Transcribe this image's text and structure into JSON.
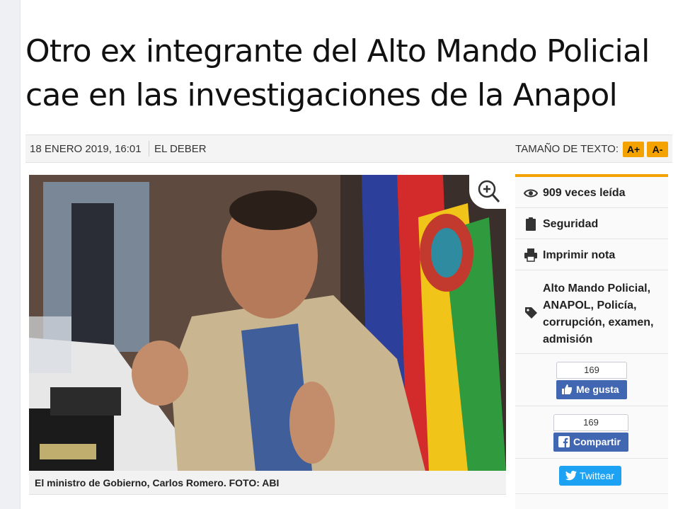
{
  "article": {
    "headline": "Otro ex integrante del Alto Mando Policial cae en las investigaciones de la Anapol",
    "date": "18 ENERO 2019, 16:01",
    "source": "EL DEBER",
    "text_size_label": "TAMAÑO DE TEXTO:",
    "text_size_increase": "A+",
    "text_size_decrease": "A-",
    "photo_caption": "El ministro de Gobierno, Carlos Romero. FOTO: ABI"
  },
  "sidebar": {
    "views": "909 veces leída",
    "category": "Seguridad",
    "print": "Imprimir nota",
    "tags": "Alto Mando Policial, ANAPOL, Policía, corrupción, examen, admisión",
    "like_count": "169",
    "like_label": "Me gusta",
    "share_count": "169",
    "share_label": "Compartir",
    "tweet_label": "Twittear"
  },
  "icons": {
    "zoom": "zoom-in-icon",
    "views": "eye-icon",
    "category": "clipboard-icon",
    "print": "printer-icon",
    "tags": "tag-icon",
    "like": "thumbs-up-icon",
    "share": "facebook-icon",
    "tweet": "twitter-bird-icon"
  },
  "colors": {
    "accent": "#f3a200",
    "facebook": "#4267b2",
    "twitter": "#1da1f2"
  }
}
